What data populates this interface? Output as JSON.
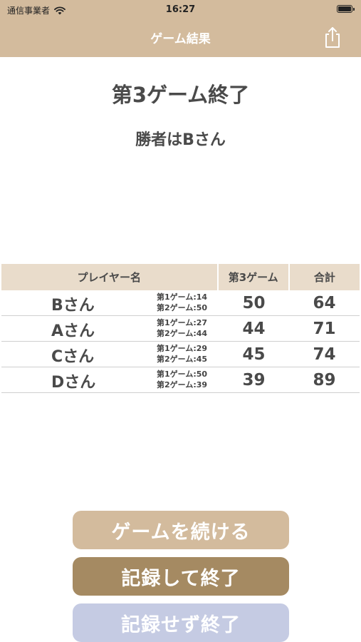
{
  "status_bar": {
    "carrier": "通信事業者",
    "time": "16:27"
  },
  "nav": {
    "title": "ゲーム結果",
    "share_icon": "share-icon"
  },
  "result": {
    "title": "第3ゲーム終了",
    "winner": "勝者はBさん"
  },
  "table": {
    "headers": {
      "name": "プレイヤー名",
      "game": "第3ゲーム",
      "total": "合計"
    },
    "rows": [
      {
        "name": "Bさん",
        "prev1": "第1ゲーム:14",
        "prev2": "第2ゲーム:50",
        "score": "50",
        "total": "64"
      },
      {
        "name": "Aさん",
        "prev1": "第1ゲーム:27",
        "prev2": "第2ゲーム:44",
        "score": "44",
        "total": "71"
      },
      {
        "name": "Cさん",
        "prev1": "第1ゲーム:29",
        "prev2": "第2ゲーム:45",
        "score": "45",
        "total": "74"
      },
      {
        "name": "Dさん",
        "prev1": "第1ゲーム:50",
        "prev2": "第2ゲーム:39",
        "score": "39",
        "total": "89"
      }
    ]
  },
  "buttons": {
    "continue": "ゲームを続ける",
    "save_and_end": "記録して終了",
    "end_without_save": "記録せず終了"
  },
  "colors": {
    "header": "#d3bb9d",
    "table_header": "#e9dccb",
    "continue_button": "#d3bb9d",
    "save_button": "#a58a62",
    "nosave_button": "#c5cbe3"
  }
}
